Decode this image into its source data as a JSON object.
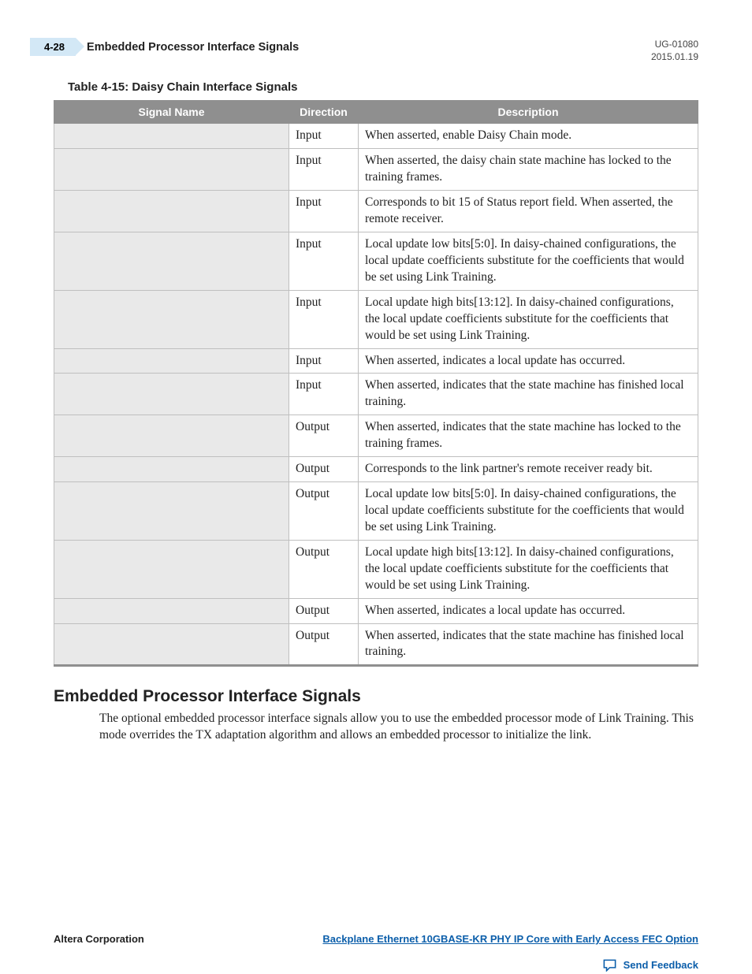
{
  "header": {
    "page_number": "4-28",
    "section_title": "Embedded Processor Interface Signals",
    "doc_id": "UG-01080",
    "doc_date": "2015.01.19"
  },
  "table": {
    "caption": "Table 4-15: Daisy Chain Interface Signals",
    "columns": [
      "Signal Name",
      "Direction",
      "Description"
    ],
    "rows": [
      {
        "signal": "",
        "direction": "Input",
        "description": "When asserted, enable Daisy Chain mode."
      },
      {
        "signal": "",
        "direction": "Input",
        "description": "When asserted, the daisy chain state machine has locked to the training frames."
      },
      {
        "signal": "",
        "direction": "Input",
        "description": "Corresponds to bit 15 of Status report field. When asserted, the remote receiver."
      },
      {
        "signal": "",
        "direction": "Input",
        "description": "Local update low bits[5:0]. In daisy-chained configurations, the local update coefficients substitute for the coefficients that would be set using Link Training."
      },
      {
        "signal": "",
        "direction": "Input",
        "description": "Local update high bits[13:12]. In daisy-chained configurations, the local update coefficients substitute for the coefficients that would be set using Link Training."
      },
      {
        "signal": "",
        "direction": "Input",
        "description": "When asserted, indicates a local update has occurred."
      },
      {
        "signal": "",
        "direction": "Input",
        "description": "When asserted, indicates that the state machine has finished local training."
      },
      {
        "signal": "",
        "direction": "Output",
        "description": "When asserted, indicates that the state machine has locked to the training frames."
      },
      {
        "signal": "",
        "direction": "Output",
        "description": "Corresponds to the link partner's remote receiver ready bit."
      },
      {
        "signal": "",
        "direction": "Output",
        "description": "Local update low bits[5:0]. In daisy-chained configurations, the local update coefficients substitute for the coefficients that would be set using Link Training."
      },
      {
        "signal": "",
        "direction": "Output",
        "description": "Local update high bits[13:12]. In daisy-chained configurations, the local update coefficients substitute for the coefficients that would be set using Link Training."
      },
      {
        "signal": "",
        "direction": "Output",
        "description": "When asserted, indicates a local update has occurred."
      },
      {
        "signal": "",
        "direction": "Output",
        "description": "When asserted, indicates that the state machine has finished local training."
      }
    ]
  },
  "section": {
    "heading": "Embedded Processor Interface Signals",
    "paragraph": "The optional embedded processor interface signals allow you to use the embedded processor mode of Link Training. This mode overrides the TX adaptation algorithm and allows an embedded processor to initialize the link."
  },
  "footer": {
    "company": "Altera Corporation",
    "doc_link": "Backplane Ethernet 10GBASE-KR PHY IP Core with Early Access FEC Option",
    "feedback_label": "Send Feedback"
  }
}
